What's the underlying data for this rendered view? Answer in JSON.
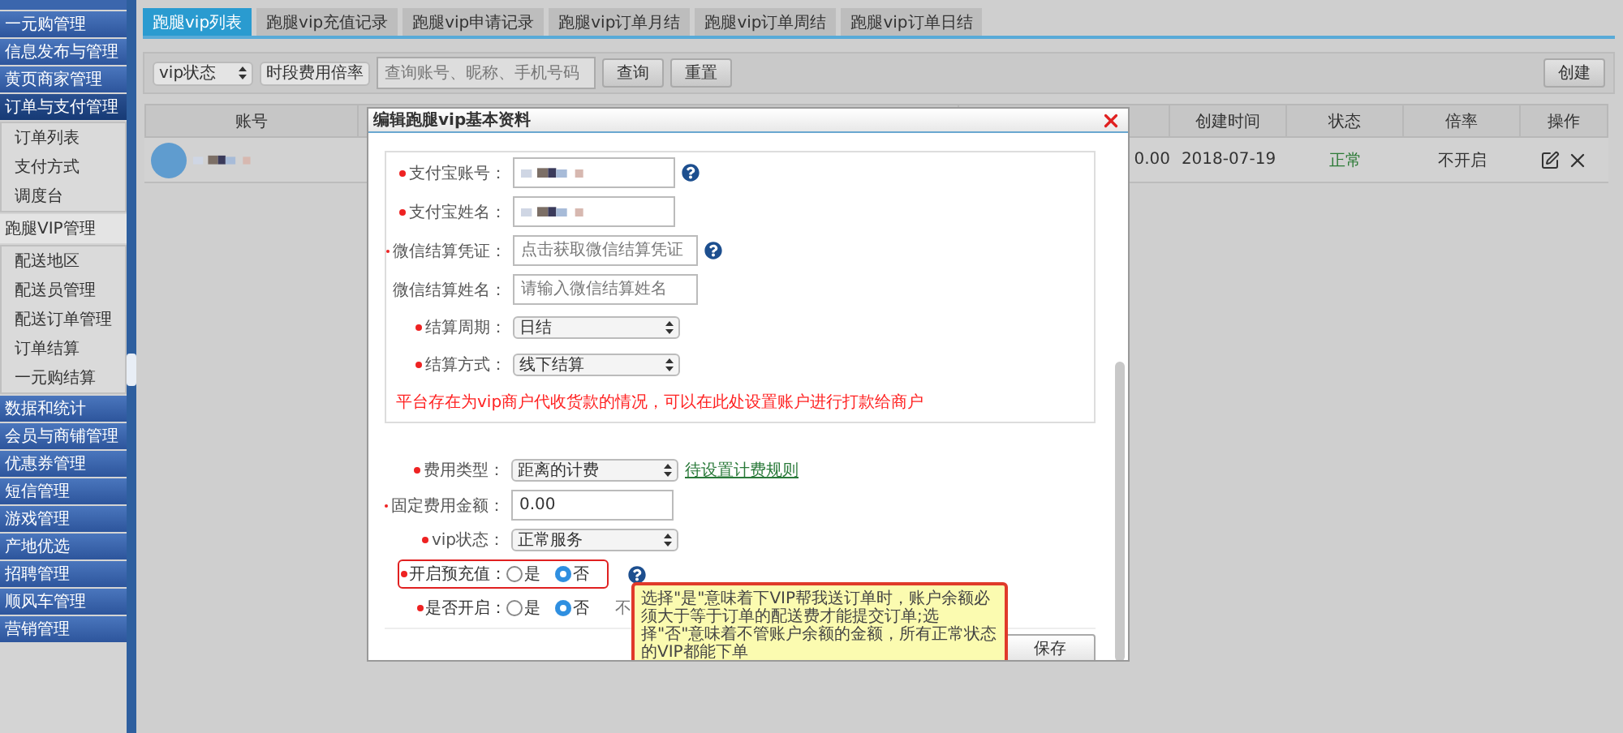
{
  "sidebar": {
    "groups": [
      {
        "label": "一元购管理",
        "kind": "header"
      },
      {
        "label": "信息发布与管理",
        "kind": "header"
      },
      {
        "label": "黄页商家管理",
        "kind": "header"
      },
      {
        "label": "订单与支付管理",
        "kind": "header",
        "expanded": true,
        "children": [
          {
            "label": "订单列表"
          },
          {
            "label": "支付方式"
          },
          {
            "label": "调度台"
          }
        ]
      },
      {
        "label": "跑腿VIP管理",
        "kind": "plain",
        "expanded": true,
        "children": [
          {
            "label": "配送地区"
          },
          {
            "label": "配送员管理"
          },
          {
            "label": "配送订单管理"
          },
          {
            "label": "订单结算"
          },
          {
            "label": "一元购结算"
          }
        ]
      },
      {
        "label": "数据和统计",
        "kind": "header"
      },
      {
        "label": "会员与商铺管理",
        "kind": "header"
      },
      {
        "label": "优惠券管理",
        "kind": "header"
      },
      {
        "label": "短信管理",
        "kind": "header"
      },
      {
        "label": "游戏管理",
        "kind": "header"
      },
      {
        "label": "产地优选",
        "kind": "header"
      },
      {
        "label": "招聘管理",
        "kind": "header"
      },
      {
        "label": "顺风车管理",
        "kind": "header"
      },
      {
        "label": "营销管理",
        "kind": "header"
      }
    ]
  },
  "tabs": [
    {
      "label": "跑腿vip列表",
      "selected": true
    },
    {
      "label": "跑腿vip充值记录",
      "selected": false
    },
    {
      "label": "跑腿vip申请记录",
      "selected": false
    },
    {
      "label": "跑腿vip订单月结",
      "selected": false
    },
    {
      "label": "跑腿vip订单周结",
      "selected": false
    },
    {
      "label": "跑腿vip订单日结",
      "selected": false
    }
  ],
  "filters": {
    "selects": [
      "vip状态",
      "时段费用倍率"
    ],
    "search": {
      "placeholder": "查询账号、昵称、手机号码"
    },
    "buttons": [
      "查询",
      "重置"
    ],
    "create_button": "创建"
  },
  "table": {
    "columns": [
      "账号",
      "创建时间",
      "状态",
      "倍率",
      "操作"
    ],
    "rows": [
      {
        "amount": "0.00",
        "created": "2018-07-19",
        "status": "正常",
        "rate": "不开启"
      }
    ]
  },
  "modal": {
    "title": "编辑跑腿vip基本资料",
    "settlement_fields": [
      {
        "kind": "blurred",
        "label": "支付宝账号：",
        "required": true,
        "help": true
      },
      {
        "kind": "blurred",
        "label": "支付宝姓名：",
        "required": true,
        "help": false
      },
      {
        "kind": "input",
        "label": "微信结算凭证：",
        "required": true,
        "placeholder": "点击获取微信结算凭证",
        "help": true
      },
      {
        "kind": "input",
        "label": "微信结算姓名：",
        "required": false,
        "placeholder": "请输入微信结算姓名",
        "help": false
      },
      {
        "kind": "select",
        "label": "结算周期：",
        "required": true,
        "value": "日结",
        "help": false
      },
      {
        "kind": "select",
        "label": "结算方式：",
        "required": true,
        "value": "线下结算",
        "help": false
      }
    ],
    "note": "平台存在为vip商户代收货款的情况，可以在此处设置账户进行打款给商户",
    "fields": [
      {
        "kind": "select",
        "label": "费用类型：",
        "required": true,
        "value": "距离的计费",
        "link": "待设置计费规则",
        "help": false
      },
      {
        "kind": "input",
        "label": "固定费用金额：",
        "required": true,
        "value": "0.00",
        "help": false
      },
      {
        "kind": "select",
        "label": "vip状态：",
        "required": true,
        "value": "正常服务",
        "help": false
      }
    ],
    "radio_rows": [
      {
        "label": "开启预充值：",
        "required": true,
        "highlighted": true,
        "help": true,
        "options": [
          {
            "label": "是",
            "selected": false
          },
          {
            "label": "否",
            "selected": true
          }
        ]
      },
      {
        "label": "是否开启：",
        "required": true,
        "highlighted": false,
        "help": false,
        "note": "不",
        "options": [
          {
            "label": "是",
            "selected": false
          },
          {
            "label": "否",
            "selected": true
          }
        ]
      }
    ],
    "tooltip": "选择\"是\"意味着下VIP帮我送订单时，账户余额必须大于等于订单的配送费才能提交订单;选择\"否\"意味着不管账户余额的金额，所有正常状态的VIP都能下单",
    "save_button": "保存"
  }
}
